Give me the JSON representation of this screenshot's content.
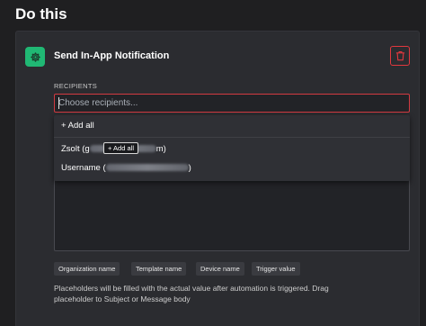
{
  "page": {
    "title": "Do this"
  },
  "action": {
    "title": "Send In-App Notification",
    "icon": "gear-icon",
    "accent_color": "#20b874",
    "delete_icon": "trash-icon",
    "danger_color": "#e0383e"
  },
  "recipients": {
    "label": "RECIPIENTS",
    "placeholder": "Choose recipients..."
  },
  "dropdown": {
    "add_all_label": "+ Add all",
    "items": [
      {
        "prefix": "Zsolt (g",
        "suffix": "m)"
      },
      {
        "prefix": "Username (",
        "suffix": ")"
      }
    ]
  },
  "tooltip": {
    "label": "+ Add all"
  },
  "placeholders": {
    "chips": [
      "Organization name",
      "Template name",
      "Device name",
      "Trigger value"
    ],
    "help_text": "Placeholders will be filled with the actual value after automation is triggered. Drag placeholder to Subject or Message body"
  }
}
